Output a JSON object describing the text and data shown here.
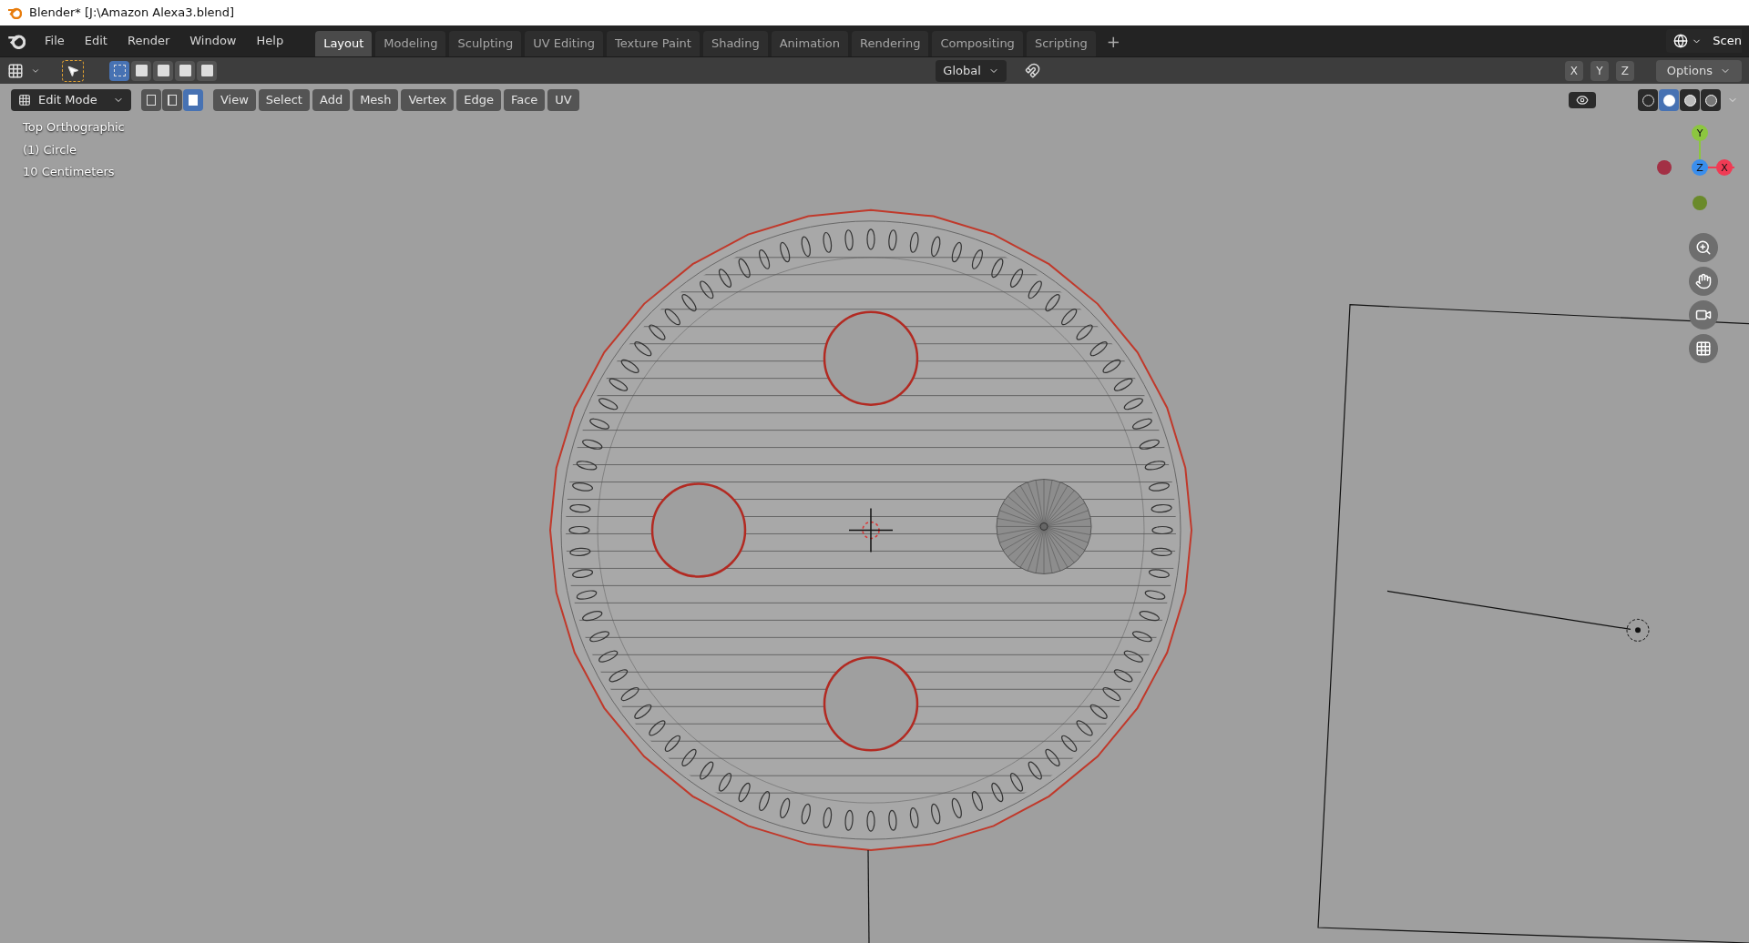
{
  "window": {
    "title": "Blender* [J:\\Amazon Alexa3.blend]"
  },
  "menu": [
    "File",
    "Edit",
    "Render",
    "Window",
    "Help"
  ],
  "workspace_tabs": [
    {
      "label": "Layout",
      "selected": true
    },
    {
      "label": "Modeling",
      "selected": false
    },
    {
      "label": "Sculpting",
      "selected": false
    },
    {
      "label": "UV Editing",
      "selected": false
    },
    {
      "label": "Texture Paint",
      "selected": false
    },
    {
      "label": "Shading",
      "selected": false
    },
    {
      "label": "Animation",
      "selected": false
    },
    {
      "label": "Rendering",
      "selected": false
    },
    {
      "label": "Compositing",
      "selected": false
    },
    {
      "label": "Scripting",
      "selected": false
    }
  ],
  "add_tab": "+",
  "scene": "Scen",
  "tool_header": {
    "select_modes": [
      {
        "selected": true
      },
      {
        "selected": false
      },
      {
        "selected": false
      },
      {
        "selected": false
      },
      {
        "selected": false
      }
    ],
    "orientation": "Global",
    "axes": [
      "X",
      "Y",
      "Z"
    ],
    "options": "Options"
  },
  "viewport_header": {
    "mode": "Edit Mode",
    "element_modes": [
      {
        "kind": "vertex",
        "selected": false
      },
      {
        "kind": "edge",
        "selected": false
      },
      {
        "kind": "face",
        "selected": true
      }
    ],
    "menus": [
      "View",
      "Select",
      "Add",
      "Mesh",
      "Vertex",
      "Edge",
      "Face",
      "UV"
    ],
    "shading": [
      {
        "kind": "wireframe",
        "selected": false
      },
      {
        "kind": "solid",
        "selected": true
      },
      {
        "kind": "material",
        "selected": false
      },
      {
        "kind": "rendered",
        "selected": false
      }
    ]
  },
  "overlay_text": [
    "Top Orthographic",
    "(1) Circle",
    "10 Centimeters"
  ],
  "gizmo": [
    {
      "label": "Y",
      "color": "#8cc63f"
    },
    {
      "label": "Z",
      "color": "#3a8eed"
    },
    {
      "label": "X",
      "color": "#f03b54"
    }
  ]
}
